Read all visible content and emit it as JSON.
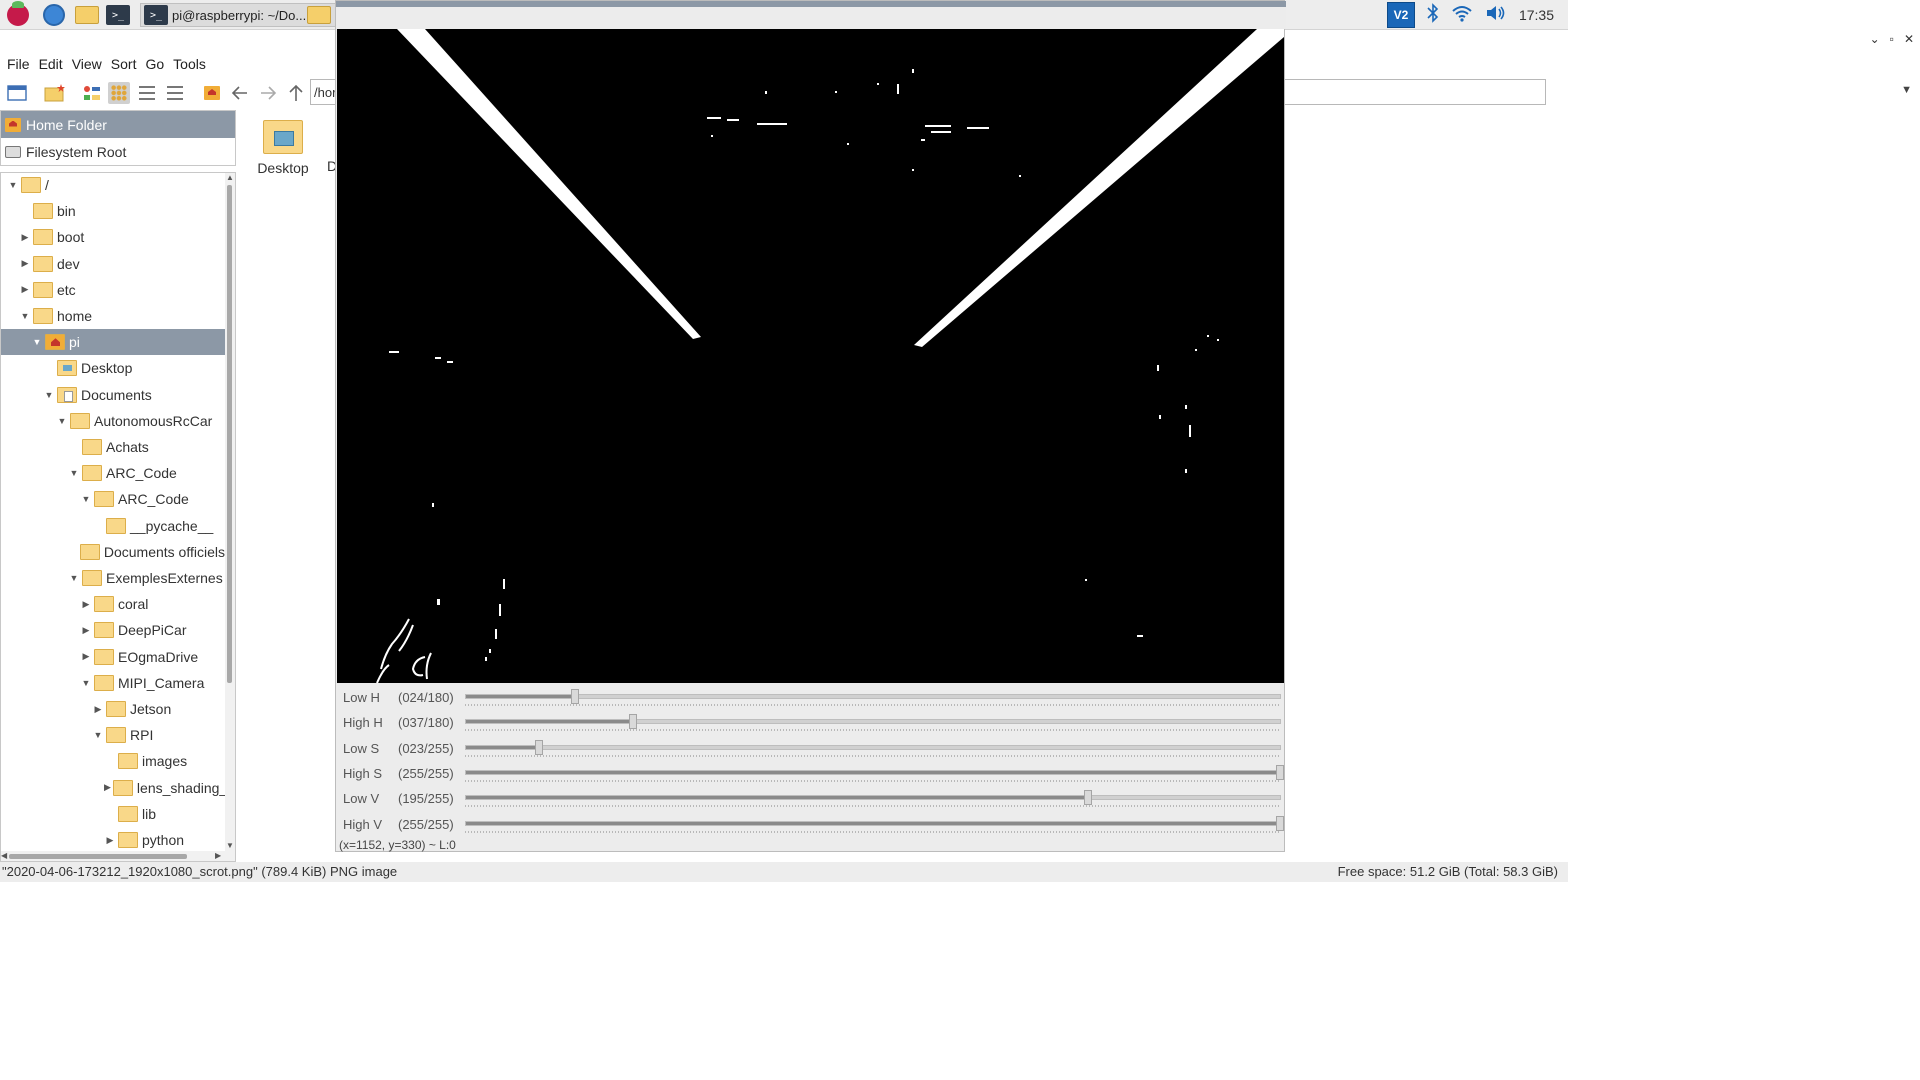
{
  "taskbar": {
    "terminal_task": "pi@raspberrypi: ~/Do...",
    "terminal_glyph": ">_",
    "vnc_label": "V2",
    "clock": "17:35"
  },
  "file_manager": {
    "window_controls": [
      "⌄",
      "▫",
      "✕"
    ],
    "menu": [
      "File",
      "Edit",
      "View",
      "Sort",
      "Go",
      "Tools"
    ],
    "address": "/hor",
    "places": [
      {
        "label": "Home Folder",
        "icon": "home-icon",
        "selected": true
      },
      {
        "label": "Filesystem Root",
        "icon": "drive-icon",
        "selected": false
      }
    ],
    "tree": [
      {
        "label": "/",
        "depth": 0,
        "expander": "▼"
      },
      {
        "label": "bin",
        "depth": 1,
        "expander": ""
      },
      {
        "label": "boot",
        "depth": 1,
        "expander": "▶"
      },
      {
        "label": "dev",
        "depth": 1,
        "expander": "▶"
      },
      {
        "label": "etc",
        "depth": 1,
        "expander": "▶"
      },
      {
        "label": "home",
        "depth": 1,
        "expander": "▼"
      },
      {
        "label": "pi",
        "depth": 2,
        "expander": "▼",
        "icon": "home",
        "selected": true
      },
      {
        "label": "Desktop",
        "depth": 3,
        "expander": "",
        "icon": "desk"
      },
      {
        "label": "Documents",
        "depth": 3,
        "expander": "▼",
        "icon": "docs"
      },
      {
        "label": "AutonomousRcCar",
        "depth": 4,
        "expander": "▼"
      },
      {
        "label": "Achats",
        "depth": 5,
        "expander": ""
      },
      {
        "label": "ARC_Code",
        "depth": 5,
        "expander": "▼"
      },
      {
        "label": "ARC_Code",
        "depth": 6,
        "expander": "▼"
      },
      {
        "label": "__pycache__",
        "depth": 7,
        "expander": ""
      },
      {
        "label": "Documents officiels",
        "depth": 5,
        "expander": ""
      },
      {
        "label": "ExemplesExternes",
        "depth": 5,
        "expander": "▼"
      },
      {
        "label": "coral",
        "depth": 6,
        "expander": "▶"
      },
      {
        "label": "DeepPiCar",
        "depth": 6,
        "expander": "▶"
      },
      {
        "label": "EOgmaDrive",
        "depth": 6,
        "expander": "▶"
      },
      {
        "label": "MIPI_Camera",
        "depth": 6,
        "expander": "▼"
      },
      {
        "label": "Jetson",
        "depth": 7,
        "expander": "▶"
      },
      {
        "label": "RPI",
        "depth": 7,
        "expander": "▼"
      },
      {
        "label": "images",
        "depth": 8,
        "expander": ""
      },
      {
        "label": "lens_shading_ta",
        "depth": 8,
        "expander": "▶"
      },
      {
        "label": "lib",
        "depth": 8,
        "expander": ""
      },
      {
        "label": "python",
        "depth": 8,
        "expander": "▶"
      }
    ],
    "content_items": [
      "Desktop",
      "D"
    ],
    "status_left": "\"2020-04-06-173212_1920x1080_scrot.png\" (789.4 KiB) PNG image",
    "status_right": "Free space: 51.2 GiB (Total: 58.3 GiB)"
  },
  "opencv_window": {
    "trackbars": [
      {
        "name": "Low H",
        "value_text": "(024/180)",
        "value": 24,
        "max": 180
      },
      {
        "name": "High H",
        "value_text": "(037/180)",
        "value": 37,
        "max": 180
      },
      {
        "name": "Low S",
        "value_text": "(023/255)",
        "value": 23,
        "max": 255
      },
      {
        "name": "High S",
        "value_text": "(255/255)",
        "value": 255,
        "max": 255
      },
      {
        "name": "Low V",
        "value_text": "(195/255)",
        "value": 195,
        "max": 255
      },
      {
        "name": "High V",
        "value_text": "(255/255)",
        "value": 255,
        "max": 255
      }
    ],
    "coords": "(x=1152, y=330) ~ L:0"
  }
}
